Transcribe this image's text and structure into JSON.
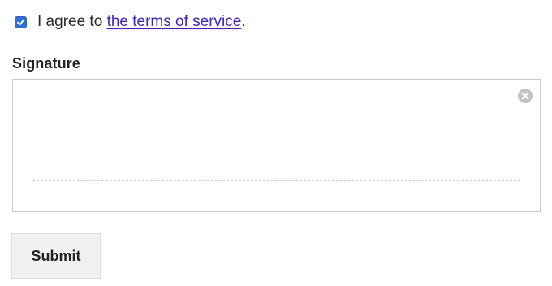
{
  "agree": {
    "checked": true,
    "text_before": "I agree to ",
    "link_text": "the terms of service",
    "text_after": "."
  },
  "signature": {
    "label": "Signature",
    "clear_icon": "clear-circle-x-icon"
  },
  "submit": {
    "label": "Submit"
  },
  "colors": {
    "checkbox": "#2f6fdc",
    "link": "#3b24d6",
    "button_bg": "#f1f1f1"
  }
}
